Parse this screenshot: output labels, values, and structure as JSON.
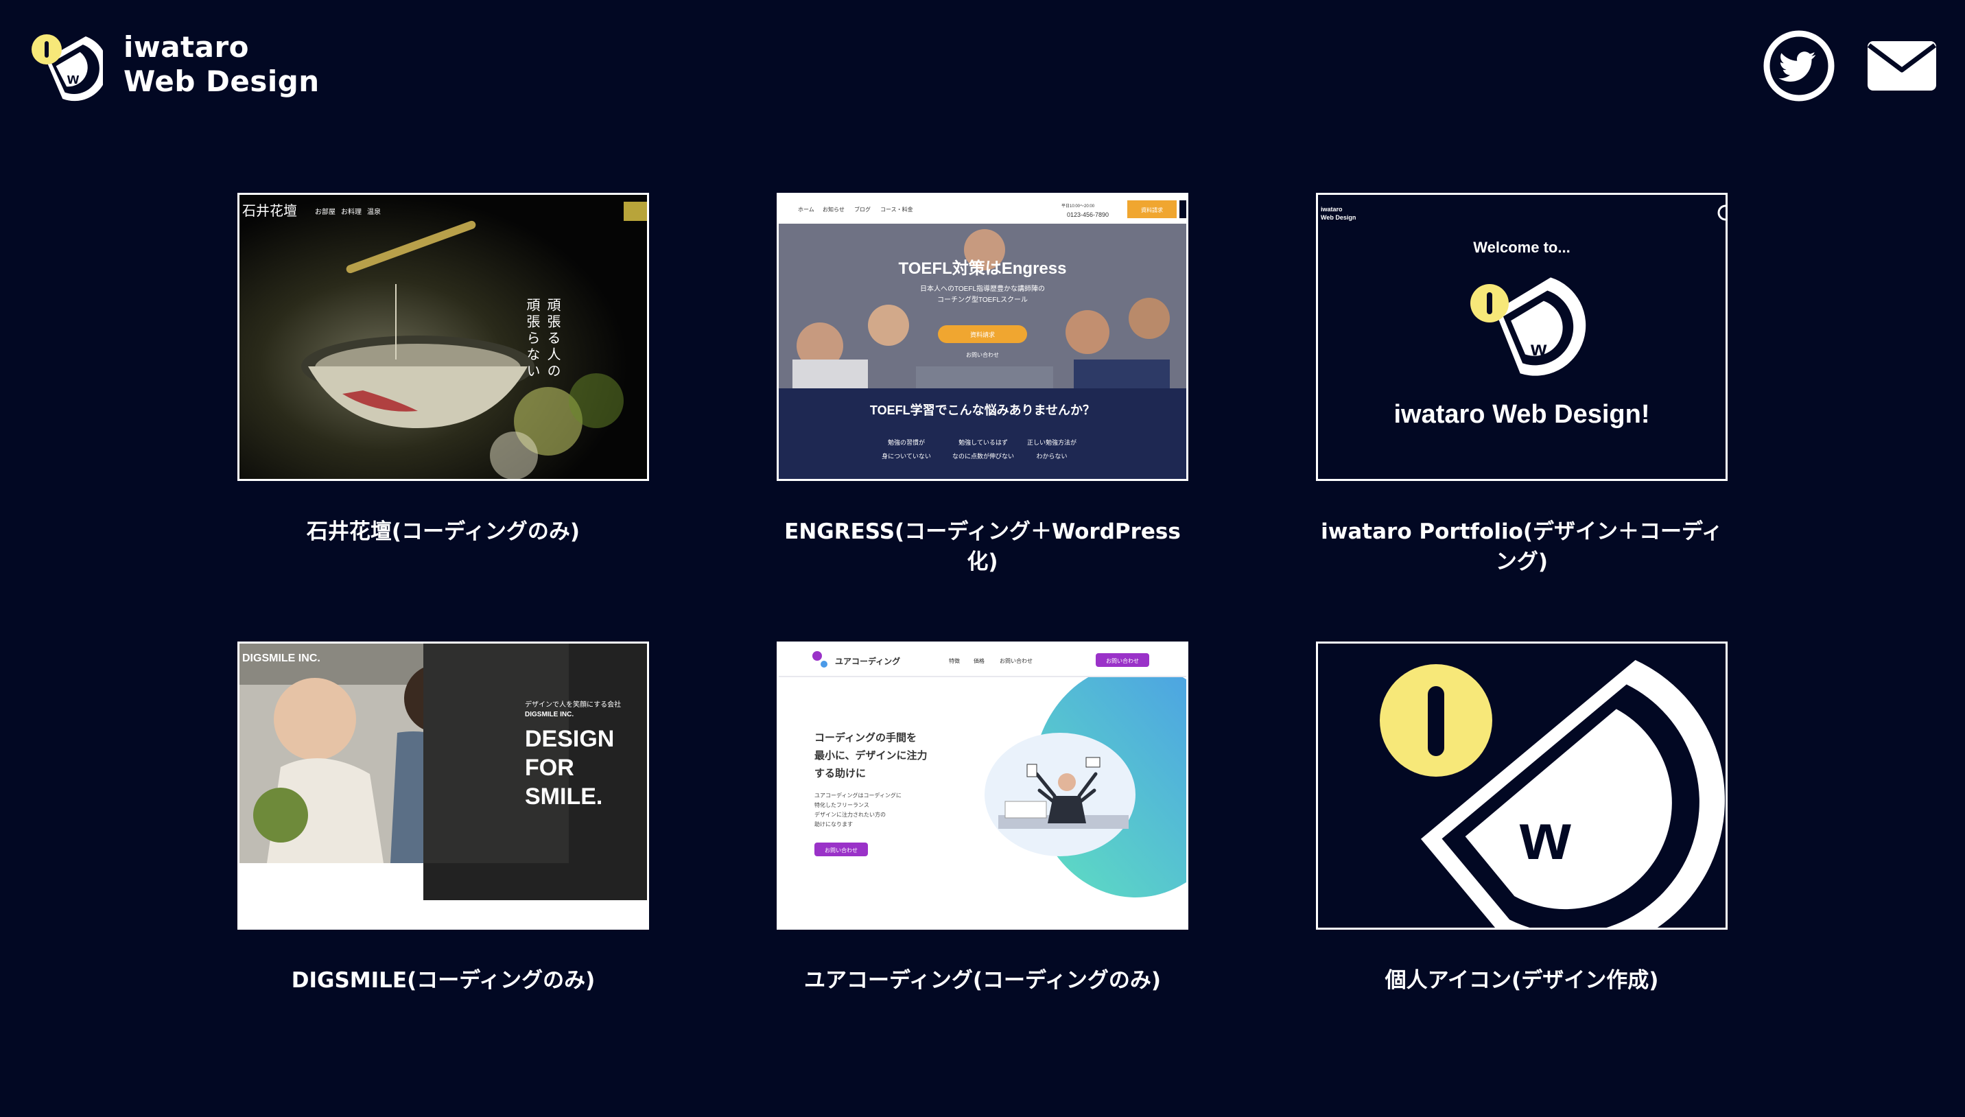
{
  "header": {
    "brand_line1": "iwataro",
    "brand_line2": "Web Design",
    "logo_icon": "iwataro-logo-icon",
    "twitter_icon": "twitter-icon",
    "mail_icon": "mail-icon"
  },
  "works": [
    {
      "title": "石井花壇(コーディングのみ)",
      "thumb": {
        "logo": "石井花壇",
        "nav": [
          "お部屋",
          "お料理",
          "温泉"
        ],
        "vertical_text": [
          "頑張る人の",
          "頑張らない"
        ]
      }
    },
    {
      "title": "ENGRESS(コーディング＋WordPress化)",
      "thumb": {
        "nav": [
          "ホーム",
          "お知らせ",
          "ブログ",
          "コース・料金"
        ],
        "hours": "平日10:00〜20:00",
        "phone": "0123-456-7890",
        "cta": "資料請求",
        "hero_title": "TOEFL対策はEngress",
        "hero_sub1": "日本人へのTOEFL指導歴豊かな講師陣の",
        "hero_sub2": "コーチング型TOEFLスクール",
        "hero_button": "資料請求",
        "hero_link": "お問い合わせ",
        "section_title": "TOEFL学習でこんな悩みありませんか？",
        "worries": [
          [
            "勉強の習慣が",
            "身についていない"
          ],
          [
            "勉強しているはず",
            "なのに点数が伸びない"
          ],
          [
            "正しい勉強方法が",
            "わからない"
          ]
        ]
      }
    },
    {
      "title": "iwataro Portfolio(デザイン＋コーディング)",
      "thumb": {
        "corner_brand": [
          "iwataro",
          "Web Design"
        ],
        "welcome": "Welcome to...",
        "headline": "iwataro Web Design!"
      }
    },
    {
      "title": "DIGSMILE(コーディングのみ)",
      "thumb": {
        "logo": "DIGSMILE INC.",
        "tagline1": "デザインで人を笑顔にする会社",
        "tagline2": "DIGSMILE INC.",
        "headline": [
          "DESIGN",
          "FOR",
          "SMILE."
        ]
      }
    },
    {
      "title": "ユアコーディング(コーディングのみ)",
      "thumb": {
        "logo": "ユアコーディング",
        "nav": [
          "特徴",
          "価格",
          "お問い合わせ"
        ],
        "nav_button": "お問い合わせ",
        "headline": [
          "コーディングの手間を",
          "最小に、デザインに注力",
          "する助けに"
        ],
        "body": [
          "ユアコーディングはコーディングに",
          "特化したフリーランス",
          "デザインに注力されたい方の",
          "助けになります"
        ],
        "button": "お問い合わせ"
      }
    },
    {
      "title": "個人アイコン(デザイン作成)",
      "thumb": {
        "icon": "iwataro-logo-icon"
      }
    }
  ],
  "colors": {
    "background": "#020823",
    "accent_yellow": "#f7e879",
    "engress_orange": "#f0a630",
    "engress_navy": "#1e2852",
    "your_coding_purple": "#9a32c8"
  }
}
